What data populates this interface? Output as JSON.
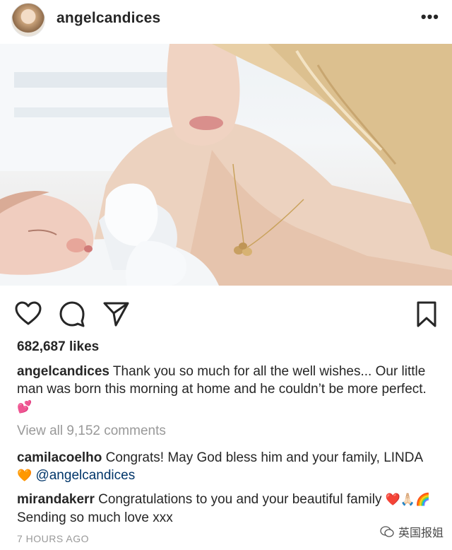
{
  "post": {
    "username": "angelcandices",
    "more_icon": "more-horizontal-icon",
    "likes": "682,687 likes",
    "caption": {
      "username": "angelcandices",
      "text": "Thank you so much for all the well wishes... Our little man was born this morning at home and he couldn’t be more perfect.",
      "emoji": "💕"
    },
    "view_all_comments": "View all 9,152 comments",
    "comments": [
      {
        "username": "camilacoelho",
        "text": "Congrats! May God bless him and your family, LINDA",
        "emoji": "🧡",
        "mention": "@angelcandices"
      },
      {
        "username": "mirandakerr",
        "text": "Congratulations to you and your beautiful family",
        "emoji": "❤️🙏🏻🌈",
        "text2": "Sending so much love xxx"
      }
    ],
    "timestamp": "7 HOURS AGO"
  },
  "actions": {
    "like_icon": "heart-icon",
    "comment_icon": "comment-icon",
    "share_icon": "send-icon",
    "save_icon": "bookmark-icon"
  },
  "watermark": {
    "text": "英国报姐"
  }
}
